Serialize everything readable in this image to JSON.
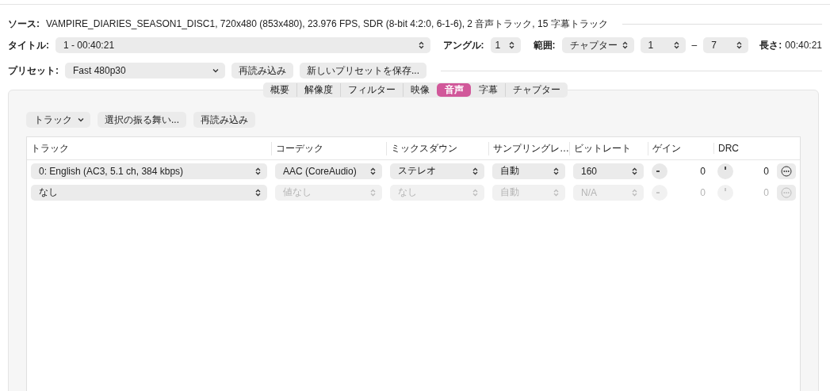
{
  "source": {
    "label": "ソース:",
    "value": "VAMPIRE_DIARIES_SEASON1_DISC1, 720x480 (853x480), 23.976 FPS, SDR (8-bit 4:2:0, 6-1-6), 2 音声トラック, 15 字幕トラック"
  },
  "title_row": {
    "title_label": "タイトル:",
    "title_value": "1 - 00:40:21",
    "angle_label": "アングル:",
    "angle_value": "1",
    "range_label": "範囲:",
    "range_kind": "チャプター",
    "range_from": "1",
    "range_dash": "–",
    "range_to": "7",
    "duration_label": "長さ:",
    "duration_value": "00:40:21"
  },
  "preset_row": {
    "label": "プリセット:",
    "value": "Fast 480p30",
    "buttons": [
      "再読み込み",
      "新しいプリセットを保存..."
    ]
  },
  "tabs": [
    {
      "label": "概要",
      "selected": false
    },
    {
      "label": "解像度",
      "selected": false
    },
    {
      "label": "フィルター",
      "selected": false
    },
    {
      "label": "映像",
      "selected": false
    },
    {
      "label": "音声",
      "selected": true
    },
    {
      "label": "字幕",
      "selected": false
    },
    {
      "label": "チャプター",
      "selected": false
    }
  ],
  "toolbar": {
    "track_menu": "トラック",
    "buttons": [
      "選択の振る舞い...",
      "再読み込み"
    ]
  },
  "table": {
    "columns": [
      "トラック",
      "コーデック",
      "ミックスダウン",
      "サンプリングレ…",
      "ビットレート",
      "ゲイン",
      "DRC"
    ],
    "rows": [
      {
        "track": "0: English (AC3, 5.1 ch, 384 kbps)",
        "codec": "AAC (CoreAudio)",
        "mixdown": "ステレオ",
        "samplerate": "自動",
        "bitrate": "160",
        "gain": "0",
        "drc": "0",
        "disabled": false
      },
      {
        "track": "なし",
        "codec": "値なし",
        "mixdown": "なし",
        "samplerate": "自動",
        "bitrate": "N/A",
        "gain": "0",
        "drc": "0",
        "disabled": true
      }
    ]
  }
}
